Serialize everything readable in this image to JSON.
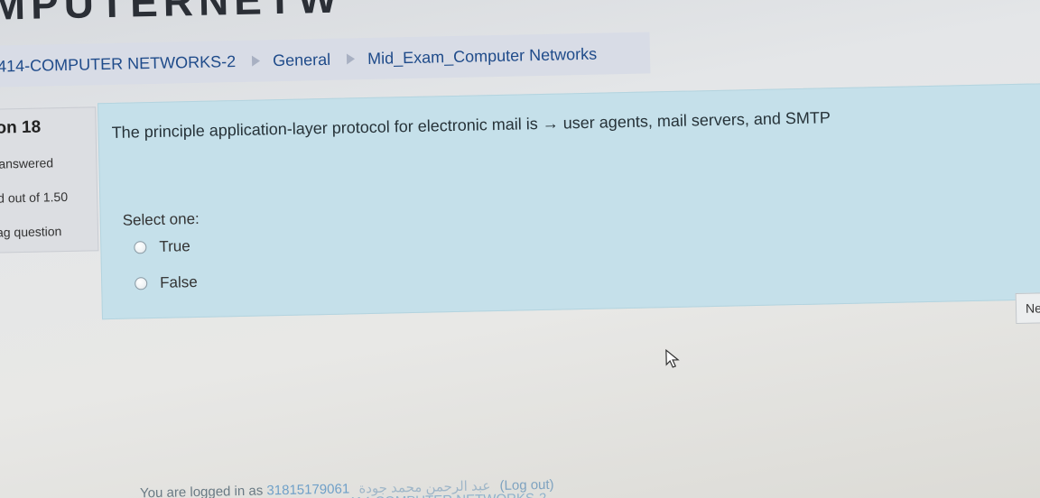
{
  "header": {
    "title_fragment": "MPUTERNETW"
  },
  "breadcrumb": {
    "items": [
      {
        "label": "414-COMPUTER NETWORKS-2"
      },
      {
        "label": "General"
      },
      {
        "label": "Mid_Exam_Computer Networks"
      }
    ]
  },
  "question_info": {
    "number_label": "on 18",
    "status": "answered",
    "mark": "d out of 1.50",
    "flag": "ag question"
  },
  "question": {
    "text": "The principle application-layer protocol for electronic mail is → user agents, mail servers, and SMTP",
    "prompt": "Select one:",
    "options": [
      {
        "label": "True",
        "checked": false
      },
      {
        "label": "False",
        "checked": false
      }
    ]
  },
  "navigation": {
    "next_label": "Ne"
  },
  "footer": {
    "logged_in_prefix": "You are logged in as",
    "user_id": "31815179061",
    "user_name": "عبد الرحمن محمد جودة",
    "logout_label": "(Log out)",
    "course_link": "414-COMPUTER NETWORKS-2"
  },
  "colors": {
    "question_panel": "#c5e0ea",
    "breadcrumb_bar": "#d8dce6",
    "link": "#1f4b8a"
  }
}
